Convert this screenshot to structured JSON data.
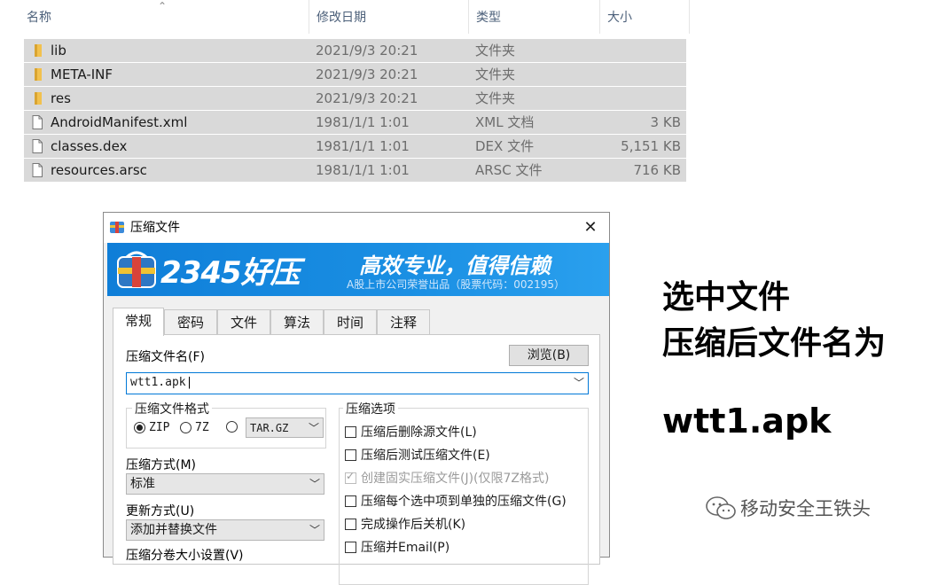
{
  "explorer": {
    "columns": {
      "name": "名称",
      "date": "修改日期",
      "type": "类型",
      "size": "大小"
    },
    "files": [
      {
        "name": "lib",
        "date": "2021/9/3 20:21",
        "type": "文件夹",
        "size": "",
        "icon": "folder-icon"
      },
      {
        "name": "META-INF",
        "date": "2021/9/3 20:21",
        "type": "文件夹",
        "size": "",
        "icon": "folder-icon"
      },
      {
        "name": "res",
        "date": "2021/9/3 20:21",
        "type": "文件夹",
        "size": "",
        "icon": "folder-icon"
      },
      {
        "name": "AndroidManifest.xml",
        "date": "1981/1/1 1:01",
        "type": "XML 文档",
        "size": "3 KB",
        "icon": "file-icon"
      },
      {
        "name": "classes.dex",
        "date": "1981/1/1 1:01",
        "type": "DEX 文件",
        "size": "5,151 KB",
        "icon": "file-icon"
      },
      {
        "name": "resources.arsc",
        "date": "1981/1/1 1:01",
        "type": "ARSC 文件",
        "size": "716 KB",
        "icon": "file-icon"
      }
    ]
  },
  "dialog": {
    "title": "压缩文件",
    "close": "✕",
    "banner": {
      "brand": "2345好压",
      "slogan": "高效专业，值得信赖",
      "sub": "A股上市公司荣誉出品（股票代码：002195）"
    },
    "tabs": [
      "常规",
      "密码",
      "文件",
      "算法",
      "时间",
      "注释"
    ],
    "archive_name_label": "压缩文件名(F)",
    "browse_button": "浏览(B)",
    "archive_name_value": "wtt1.apk",
    "format_group": {
      "title": "压缩文件格式",
      "options": [
        "ZIP",
        "7Z"
      ],
      "other_format": "TAR.GZ"
    },
    "method": {
      "label": "压缩方式(M)",
      "value": "标准"
    },
    "update": {
      "label": "更新方式(U)",
      "value": "添加并替换文件"
    },
    "partial_label": "压缩分卷大小设置(V)",
    "options_group": {
      "title": "压缩选项",
      "items": [
        "压缩后删除源文件(L)",
        "压缩后测试压缩文件(E)",
        "创建固实压缩文件(J)(仅限7Z格式)",
        "压缩每个选中项到单独的压缩文件(G)",
        "完成操作后关机(K)",
        "压缩并Email(P)"
      ]
    }
  },
  "annotations": {
    "line1": "选中文件",
    "line2": "压缩后文件名为",
    "line3": "wtt1.apk"
  },
  "watermark": "移动安全王铁头",
  "colors": {
    "selection": "#d9d9d9",
    "banner": "#1a8fe3",
    "folder": "#f2c14e"
  }
}
